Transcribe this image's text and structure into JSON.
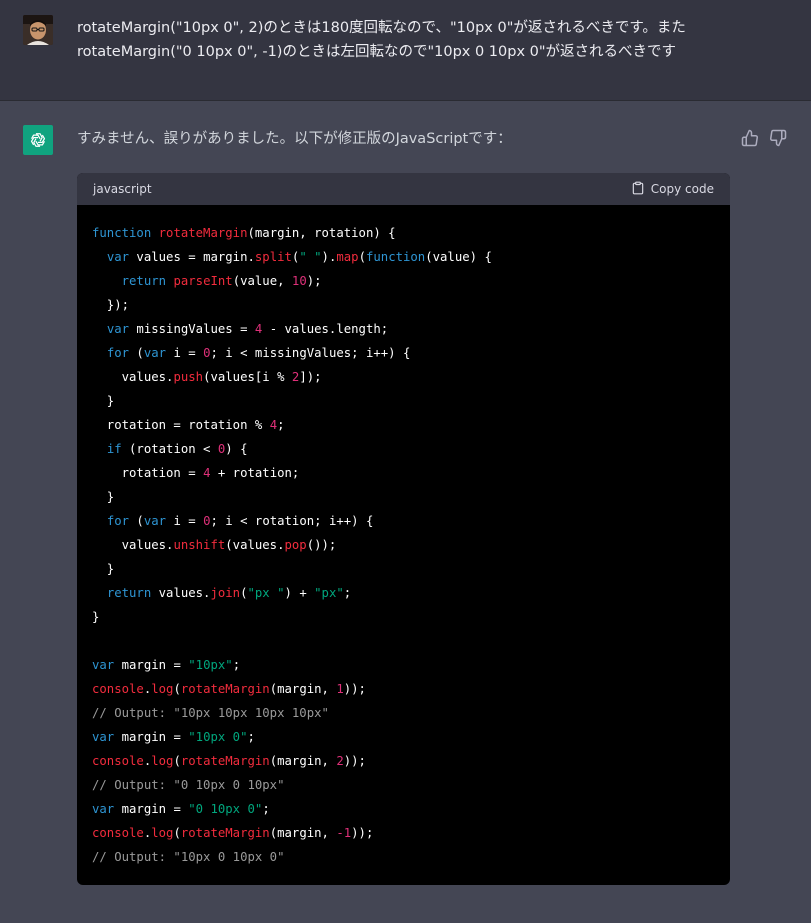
{
  "user_message": {
    "lines": [
      "rotateMargin(\"10px 0\", 2)のときは180度回転なので、\"10px 0\"が返されるべきです。また",
      "rotateMargin(\"0 10px 0\", -1)のときは左回転なので\"10px 0 10px 0\"が返されるべきです"
    ]
  },
  "assistant_message": {
    "intro": "すみません、誤りがありました。以下が修正版のJavaScriptです："
  },
  "code_block": {
    "language": "javascript",
    "copy_label": "Copy code",
    "lines": [
      [
        {
          "t": "kw",
          "v": "function "
        },
        {
          "t": "fn",
          "v": "rotateMargin"
        },
        {
          "t": "pl",
          "v": "(margin, rotation) {"
        }
      ],
      [
        {
          "t": "pl",
          "v": "  "
        },
        {
          "t": "kw",
          "v": "var"
        },
        {
          "t": "pl",
          "v": " values = margin."
        },
        {
          "t": "fn",
          "v": "split"
        },
        {
          "t": "pl",
          "v": "("
        },
        {
          "t": "str",
          "v": "\" \""
        },
        {
          "t": "pl",
          "v": ")."
        },
        {
          "t": "fn",
          "v": "map"
        },
        {
          "t": "pl",
          "v": "("
        },
        {
          "t": "kw",
          "v": "function"
        },
        {
          "t": "pl",
          "v": "(value) {"
        }
      ],
      [
        {
          "t": "pl",
          "v": "    "
        },
        {
          "t": "kw",
          "v": "return "
        },
        {
          "t": "fn",
          "v": "parseInt"
        },
        {
          "t": "pl",
          "v": "(value, "
        },
        {
          "t": "num",
          "v": "10"
        },
        {
          "t": "pl",
          "v": ");"
        }
      ],
      [
        {
          "t": "pl",
          "v": "  });"
        }
      ],
      [
        {
          "t": "pl",
          "v": "  "
        },
        {
          "t": "kw",
          "v": "var"
        },
        {
          "t": "pl",
          "v": " missingValues = "
        },
        {
          "t": "num",
          "v": "4"
        },
        {
          "t": "pl",
          "v": " - values.length;"
        }
      ],
      [
        {
          "t": "pl",
          "v": "  "
        },
        {
          "t": "kw",
          "v": "for"
        },
        {
          "t": "pl",
          "v": " ("
        },
        {
          "t": "kw",
          "v": "var"
        },
        {
          "t": "pl",
          "v": " i = "
        },
        {
          "t": "num",
          "v": "0"
        },
        {
          "t": "pl",
          "v": "; i < missingValues; i++) {"
        }
      ],
      [
        {
          "t": "pl",
          "v": "    values."
        },
        {
          "t": "fn",
          "v": "push"
        },
        {
          "t": "pl",
          "v": "(values[i % "
        },
        {
          "t": "num",
          "v": "2"
        },
        {
          "t": "pl",
          "v": "]);"
        }
      ],
      [
        {
          "t": "pl",
          "v": "  }"
        }
      ],
      [
        {
          "t": "pl",
          "v": "  rotation = rotation % "
        },
        {
          "t": "num",
          "v": "4"
        },
        {
          "t": "pl",
          "v": ";"
        }
      ],
      [
        {
          "t": "pl",
          "v": "  "
        },
        {
          "t": "kw",
          "v": "if"
        },
        {
          "t": "pl",
          "v": " (rotation < "
        },
        {
          "t": "num",
          "v": "0"
        },
        {
          "t": "pl",
          "v": ") {"
        }
      ],
      [
        {
          "t": "pl",
          "v": "    rotation = "
        },
        {
          "t": "num",
          "v": "4"
        },
        {
          "t": "pl",
          "v": " + rotation;"
        }
      ],
      [
        {
          "t": "pl",
          "v": "  }"
        }
      ],
      [
        {
          "t": "pl",
          "v": "  "
        },
        {
          "t": "kw",
          "v": "for"
        },
        {
          "t": "pl",
          "v": " ("
        },
        {
          "t": "kw",
          "v": "var"
        },
        {
          "t": "pl",
          "v": " i = "
        },
        {
          "t": "num",
          "v": "0"
        },
        {
          "t": "pl",
          "v": "; i < rotation; i++) {"
        }
      ],
      [
        {
          "t": "pl",
          "v": "    values."
        },
        {
          "t": "fn",
          "v": "unshift"
        },
        {
          "t": "pl",
          "v": "(values."
        },
        {
          "t": "fn",
          "v": "pop"
        },
        {
          "t": "pl",
          "v": "());"
        }
      ],
      [
        {
          "t": "pl",
          "v": "  }"
        }
      ],
      [
        {
          "t": "pl",
          "v": "  "
        },
        {
          "t": "kw",
          "v": "return"
        },
        {
          "t": "pl",
          "v": " values."
        },
        {
          "t": "fn",
          "v": "join"
        },
        {
          "t": "pl",
          "v": "("
        },
        {
          "t": "str",
          "v": "\"px \""
        },
        {
          "t": "pl",
          "v": ") + "
        },
        {
          "t": "str",
          "v": "\"px\""
        },
        {
          "t": "pl",
          "v": ";"
        }
      ],
      [
        {
          "t": "pl",
          "v": "}"
        }
      ],
      [],
      [
        {
          "t": "kw",
          "v": "var"
        },
        {
          "t": "pl",
          "v": " margin = "
        },
        {
          "t": "str",
          "v": "\"10px\""
        },
        {
          "t": "pl",
          "v": ";"
        }
      ],
      [
        {
          "t": "fn",
          "v": "console"
        },
        {
          "t": "pl",
          "v": "."
        },
        {
          "t": "fn",
          "v": "log"
        },
        {
          "t": "pl",
          "v": "("
        },
        {
          "t": "fn",
          "v": "rotateMargin"
        },
        {
          "t": "pl",
          "v": "(margin, "
        },
        {
          "t": "num",
          "v": "1"
        },
        {
          "t": "pl",
          "v": "));"
        }
      ],
      [
        {
          "t": "cm",
          "v": "// Output: \"10px 10px 10px 10px\""
        }
      ],
      [
        {
          "t": "kw",
          "v": "var"
        },
        {
          "t": "pl",
          "v": " margin = "
        },
        {
          "t": "str",
          "v": "\"10px 0\""
        },
        {
          "t": "pl",
          "v": ";"
        }
      ],
      [
        {
          "t": "fn",
          "v": "console"
        },
        {
          "t": "pl",
          "v": "."
        },
        {
          "t": "fn",
          "v": "log"
        },
        {
          "t": "pl",
          "v": "("
        },
        {
          "t": "fn",
          "v": "rotateMargin"
        },
        {
          "t": "pl",
          "v": "(margin, "
        },
        {
          "t": "num",
          "v": "2"
        },
        {
          "t": "pl",
          "v": "));"
        }
      ],
      [
        {
          "t": "cm",
          "v": "// Output: \"0 10px 0 10px\""
        }
      ],
      [
        {
          "t": "kw",
          "v": "var"
        },
        {
          "t": "pl",
          "v": " margin = "
        },
        {
          "t": "str",
          "v": "\"0 10px 0\""
        },
        {
          "t": "pl",
          "v": ";"
        }
      ],
      [
        {
          "t": "fn",
          "v": "console"
        },
        {
          "t": "pl",
          "v": "."
        },
        {
          "t": "fn",
          "v": "log"
        },
        {
          "t": "pl",
          "v": "("
        },
        {
          "t": "fn",
          "v": "rotateMargin"
        },
        {
          "t": "pl",
          "v": "(margin, "
        },
        {
          "t": "num",
          "v": "-1"
        },
        {
          "t": "pl",
          "v": "));"
        }
      ],
      [
        {
          "t": "cm",
          "v": "// Output: \"10px 0 10px 0\""
        }
      ]
    ]
  },
  "icons": {
    "thumb_up": "thumbs-up-icon",
    "thumb_down": "thumbs-down-icon",
    "copy": "clipboard-icon",
    "assistant_logo": "openai-logo-icon"
  },
  "colors": {
    "user_bg": "#343541",
    "assistant_bg": "#444654",
    "code_bg": "#000000",
    "code_header_bg": "#343541",
    "brand": "#10a37f",
    "keyword": "#2e95d3",
    "function": "#f22c3d",
    "number": "#df3079",
    "string": "#00a67d",
    "comment": "#9a9a9a"
  }
}
